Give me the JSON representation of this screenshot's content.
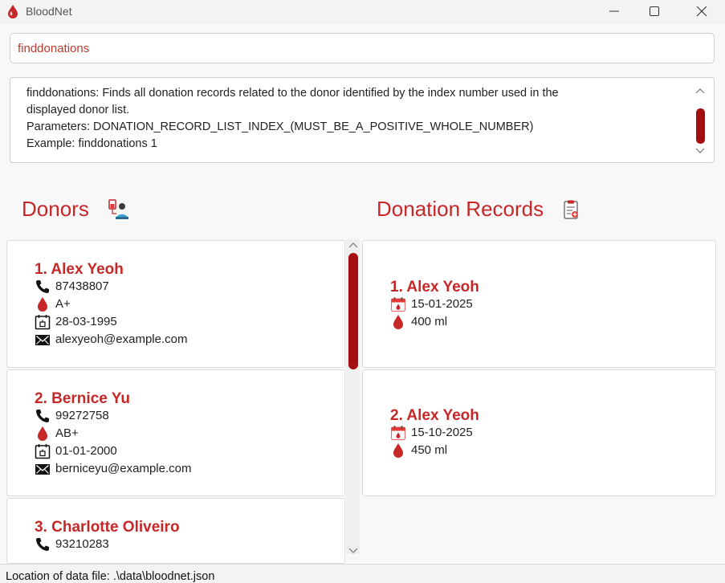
{
  "app": {
    "title": "BloodNet"
  },
  "command": {
    "value": "finddonations"
  },
  "result": {
    "lines": [
      "finddonations: Finds all donation records related to the donor identified by the index number used in the",
      "displayed donor list.",
      "Parameters: DONATION_RECORD_LIST_INDEX_(MUST_BE_A_POSITIVE_WHOLE_NUMBER)",
      "Example: finddonations 1"
    ]
  },
  "donors": {
    "title": "Donors",
    "icon": "donor-icon",
    "items": [
      {
        "name": "1. Alex Yeoh",
        "phone": "87438807",
        "blood_type": "A+",
        "dob": "28-03-1995",
        "email": "alexyeoh@example.com"
      },
      {
        "name": "2. Bernice Yu",
        "phone": "99272758",
        "blood_type": "AB+",
        "dob": "01-01-2000",
        "email": "berniceyu@example.com"
      },
      {
        "name": "3. Charlotte Oliveiro",
        "phone": "93210283"
      }
    ]
  },
  "records": {
    "title": "Donation Records",
    "icon": "clipboard-icon",
    "items": [
      {
        "name": "1. Alex Yeoh",
        "date": "15-01-2025",
        "volume": "400 ml"
      },
      {
        "name": "2. Alex Yeoh",
        "date": "15-10-2025",
        "volume": "450 ml"
      }
    ]
  },
  "status": {
    "text": "Location of data file: .\\data\\bloodnet.json"
  },
  "colors": {
    "accent": "#c62828",
    "scrollbar": "#a50e0e"
  }
}
